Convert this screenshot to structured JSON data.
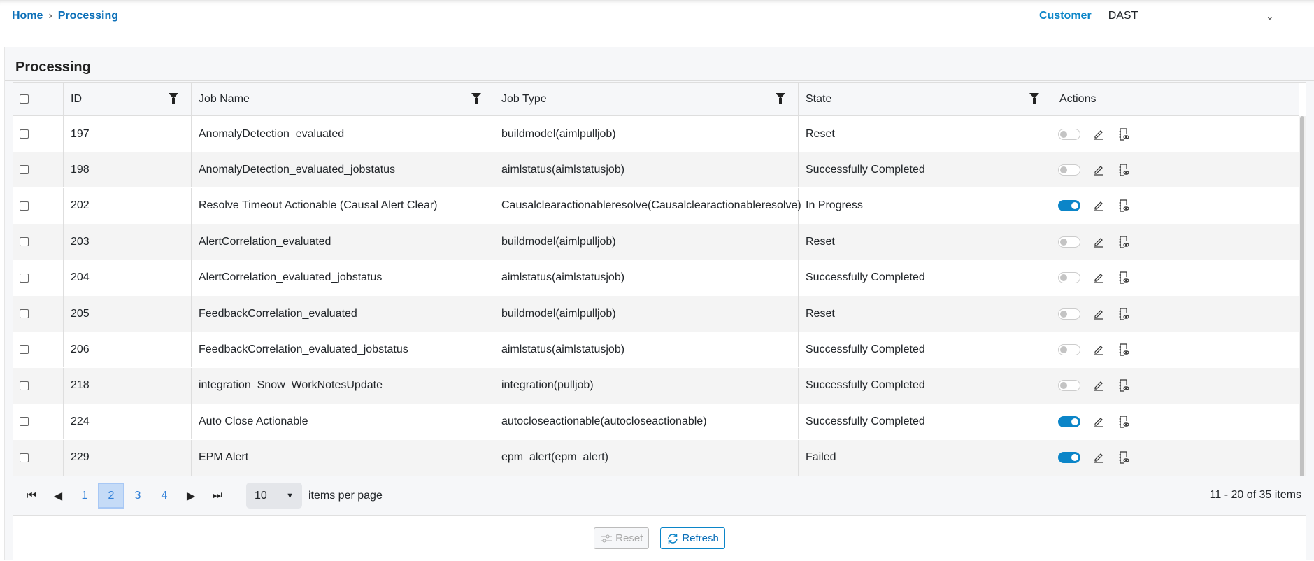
{
  "breadcrumb": {
    "home": "Home",
    "current": "Processing"
  },
  "customer": {
    "label": "Customer",
    "value": "DAST"
  },
  "panel": {
    "title": "Processing"
  },
  "table": {
    "columns": [
      "ID",
      "Job Name",
      "Job Type",
      "State",
      "Actions"
    ],
    "rows": [
      {
        "id": "197",
        "name": "AnomalyDetection_evaluated",
        "type": "buildmodel(aimlpulljob)",
        "state": "Reset",
        "enabled": false
      },
      {
        "id": "198",
        "name": "AnomalyDetection_evaluated_jobstatus",
        "type": "aimlstatus(aimlstatusjob)",
        "state": "Successfully Completed",
        "enabled": false
      },
      {
        "id": "202",
        "name": "Resolve Timeout Actionable (Causal Alert Clear)",
        "type": "Causalclearactionableresolve(Causalclearactionableresolve)",
        "state": "In Progress",
        "enabled": true
      },
      {
        "id": "203",
        "name": "AlertCorrelation_evaluated",
        "type": "buildmodel(aimlpulljob)",
        "state": "Reset",
        "enabled": false
      },
      {
        "id": "204",
        "name": "AlertCorrelation_evaluated_jobstatus",
        "type": "aimlstatus(aimlstatusjob)",
        "state": "Successfully Completed",
        "enabled": false
      },
      {
        "id": "205",
        "name": "FeedbackCorrelation_evaluated",
        "type": "buildmodel(aimlpulljob)",
        "state": "Reset",
        "enabled": false
      },
      {
        "id": "206",
        "name": "FeedbackCorrelation_evaluated_jobstatus",
        "type": "aimlstatus(aimlstatusjob)",
        "state": "Successfully Completed",
        "enabled": false
      },
      {
        "id": "218",
        "name": "integration_Snow_WorkNotesUpdate",
        "type": "integration(pulljob)",
        "state": "Successfully Completed",
        "enabled": false
      },
      {
        "id": "224",
        "name": "Auto Close Actionable",
        "type": "autocloseactionable(autocloseactionable)",
        "state": "Successfully Completed",
        "enabled": true
      },
      {
        "id": "229",
        "name": "EPM Alert",
        "type": "epm_alert(epm_alert)",
        "state": "Failed",
        "enabled": true
      }
    ]
  },
  "pager": {
    "pages": [
      "1",
      "2",
      "3",
      "4"
    ],
    "current_page": 2,
    "page_size": "10",
    "page_size_label": "items per page",
    "summary": "11 - 20 of 35 items"
  },
  "footer": {
    "reset": "Reset",
    "refresh": "Refresh"
  },
  "colors": {
    "accent": "#0b85c8",
    "link": "#0b6fb8"
  }
}
